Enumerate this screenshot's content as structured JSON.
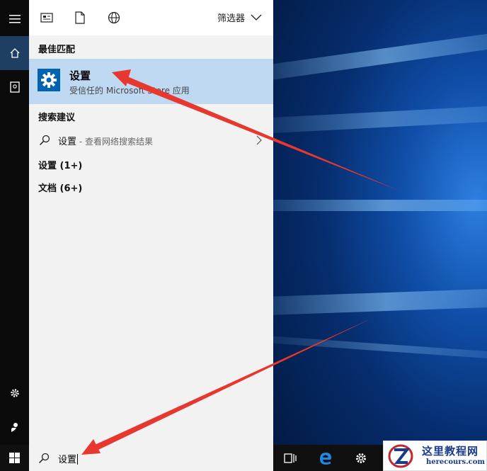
{
  "toolbar": {
    "filter_label": "筛选器",
    "icons": [
      "apps-icon",
      "document-icon",
      "web-icon"
    ]
  },
  "best_match": {
    "header": "最佳匹配",
    "title": "设置",
    "subtitle": "受信任的 Microsoft Store 应用"
  },
  "suggestions": {
    "header": "搜索建议",
    "query": "设置",
    "hint": " - 查看网络搜索结果"
  },
  "groups": [
    {
      "label": "设置 (1+)"
    },
    {
      "label": "文档 (6+)"
    }
  ],
  "search": {
    "value": "设置"
  },
  "watermark": {
    "cn": "这里教程网",
    "en": "herecours.com"
  },
  "colors": {
    "accent": "#0063b1",
    "selection": "#bfd9f2",
    "arrow": "#e8372f"
  }
}
